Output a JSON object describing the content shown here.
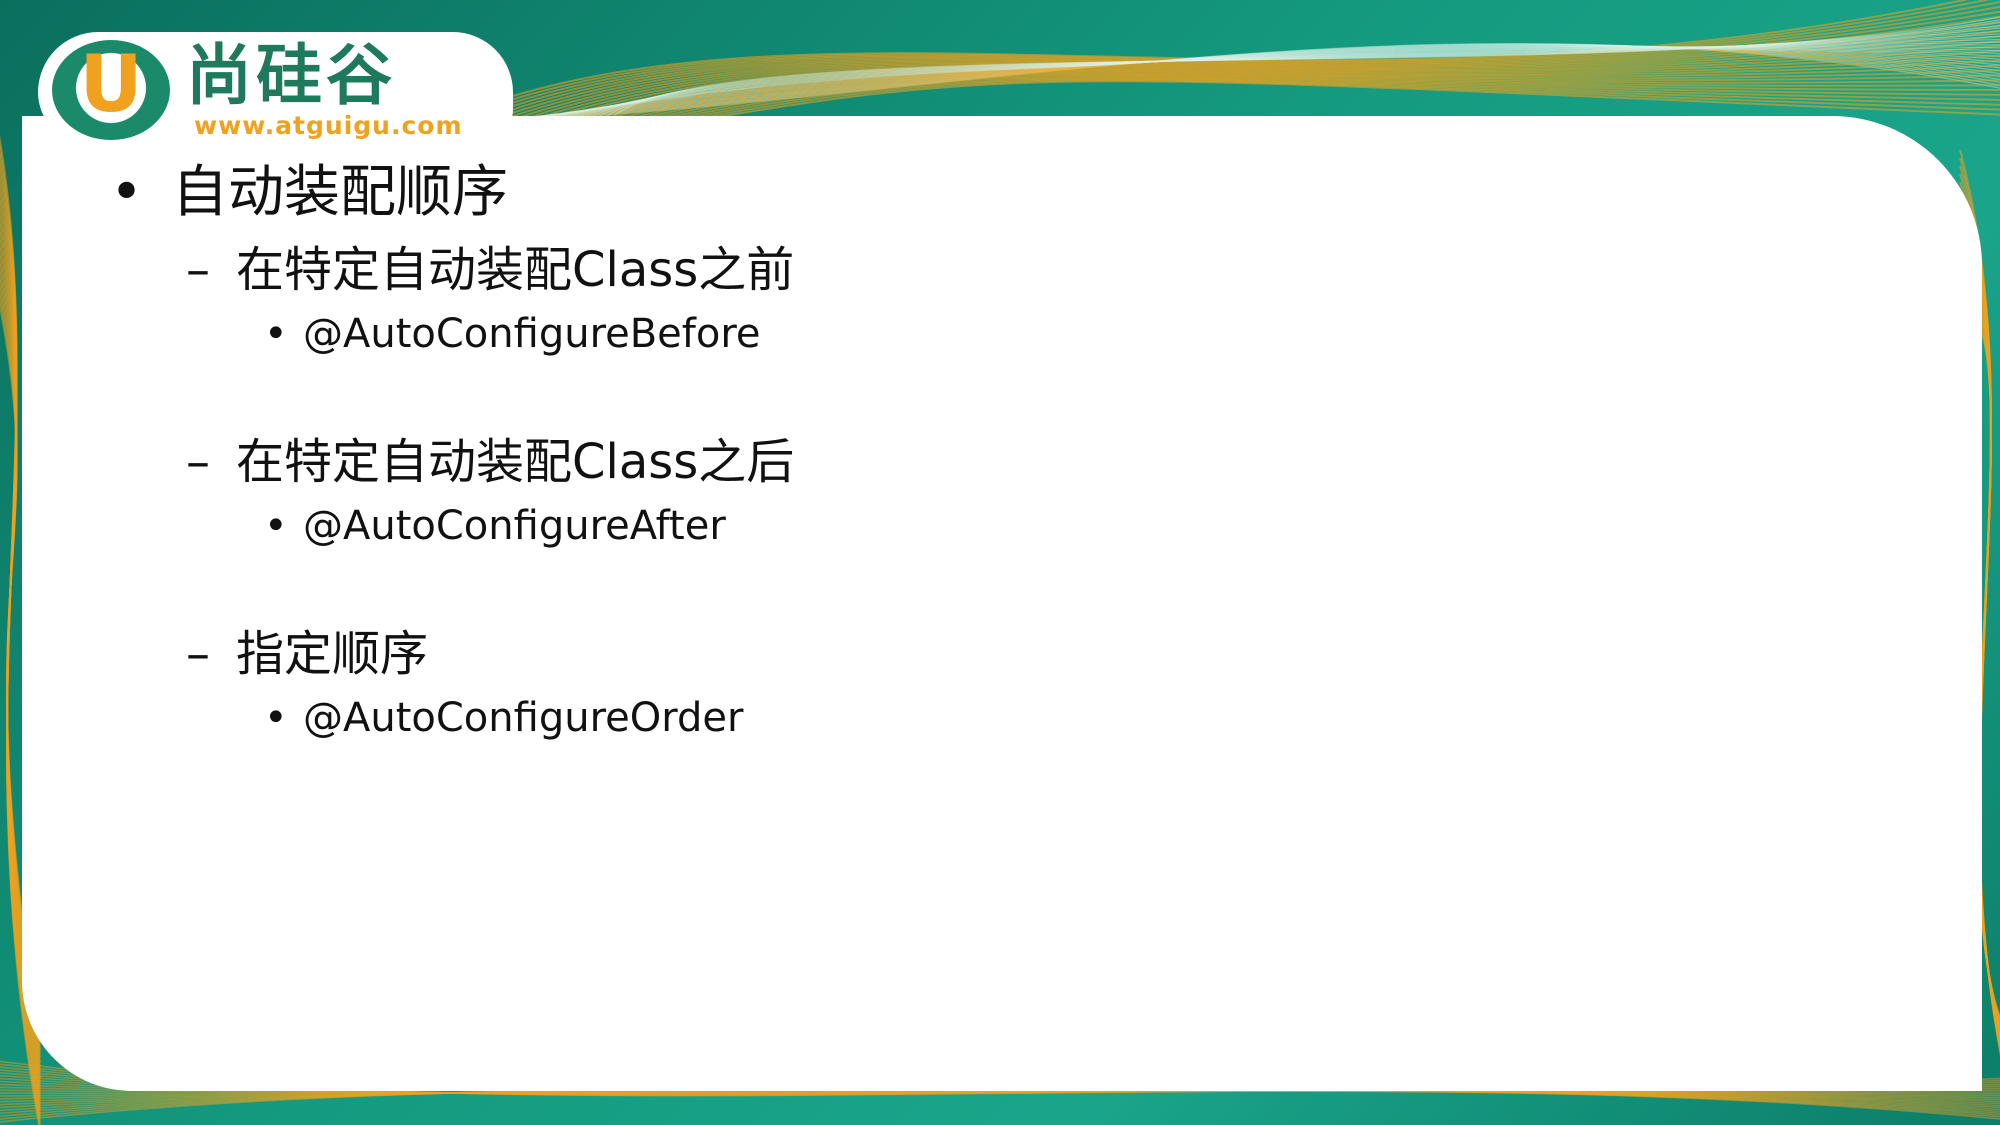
{
  "logo": {
    "letter": "U",
    "name_cn": "尚硅谷",
    "url": "www.atguigu.com"
  },
  "bullets": {
    "title": "自动装配顺序",
    "groups": [
      {
        "heading": "在特定自动装配Class之前",
        "item": "@AutoConfigureBefore"
      },
      {
        "heading": "在特定自动装配Class之后",
        "item": "@AutoConfigureAfter"
      },
      {
        "heading": "指定顺序",
        "item": "@AutoConfigureOrder"
      }
    ]
  },
  "markers": {
    "level1": "•",
    "level2": "–",
    "level3": "•"
  },
  "colors": {
    "background_green": "#149a7f",
    "wave_orange": "#f0a21e",
    "logo_green": "#1f7a5c",
    "text": "#111111",
    "panel": "#ffffff"
  }
}
